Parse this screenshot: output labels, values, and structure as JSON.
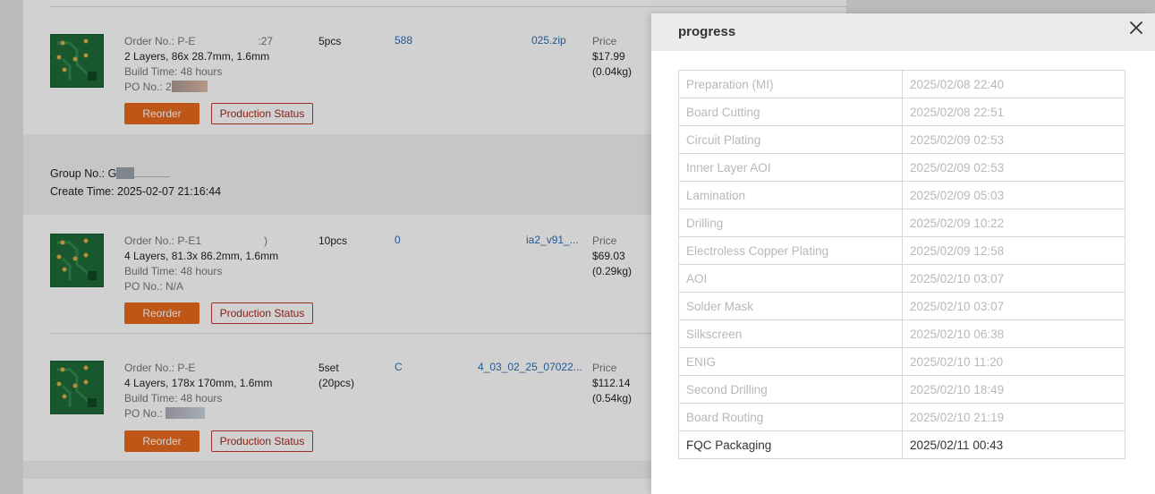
{
  "orders_top": {
    "order_no": "Order No.: P-E",
    "order_suffix": ":27",
    "specs": "2 Layers, 86x 28.7mm, 1.6mm",
    "build_time": "Build Time: 48 hours",
    "po_no": "PO No.: 2",
    "qty": "5pcs",
    "link": "588",
    "file": "025.zip",
    "price_label": "Price",
    "price": "$17.99",
    "weight": "(0.04kg)",
    "reorder": "Reorder",
    "status": "Production Status"
  },
  "group": {
    "group_no": "Group No.: G",
    "create_time": "Create Time: 2025-02-07 21:16:44"
  },
  "orders": [
    {
      "order_no": "Order No.: P-E1",
      "order_suffix": ")",
      "specs": "4 Layers, 81.3x 86.2mm, 1.6mm",
      "build_time": "Build Time: 48 hours",
      "po_no": "PO No.: N/A",
      "qty": "10pcs",
      "link": "0",
      "file": "ia2_v91_...",
      "price_label": "Price",
      "price": "$69.03",
      "weight": "(0.29kg)",
      "reorder": "Reorder",
      "status": "Production Status"
    },
    {
      "order_no": "Order No.: P-E",
      "order_suffix": "",
      "specs": "4 Layers, 178x 170mm, 1.6mm",
      "build_time": "Build Time: 48 hours",
      "po_no": "PO No.: ",
      "qty": "5set",
      "qty2": "(20pcs)",
      "link": "C",
      "file": "4_03_02_25_07022...",
      "price_label": "Price",
      "price": "$112.14",
      "weight": "(0.54kg)",
      "reorder": "Reorder",
      "status": "Production Status"
    }
  ],
  "modal": {
    "title": "progress",
    "close_icon": "close-icon",
    "steps": [
      {
        "name": "Preparation (MI)",
        "time": "2025/02/08 22:40"
      },
      {
        "name": "Board Cutting",
        "time": "2025/02/08 22:51"
      },
      {
        "name": "Circuit Plating",
        "time": "2025/02/09 02:53"
      },
      {
        "name": "Inner Layer AOI",
        "time": "2025/02/09 02:53"
      },
      {
        "name": "Lamination",
        "time": "2025/02/09 05:03"
      },
      {
        "name": "Drilling",
        "time": "2025/02/09 10:22"
      },
      {
        "name": "Electroless Copper Plating",
        "time": "2025/02/09 12:58"
      },
      {
        "name": "AOI",
        "time": "2025/02/10 03:07"
      },
      {
        "name": "Solder Mask",
        "time": "2025/02/10 03:07"
      },
      {
        "name": "Silkscreen",
        "time": "2025/02/10 06:38"
      },
      {
        "name": "ENIG",
        "time": "2025/02/10 11:20"
      },
      {
        "name": "Second Drilling",
        "time": "2025/02/10 18:49"
      },
      {
        "name": "Board Routing",
        "time": "2025/02/10 21:19"
      },
      {
        "name": "FQC Packaging",
        "time": "2025/02/11 00:43"
      }
    ]
  },
  "colors": {
    "accent": "#e8691e",
    "status_border": "#c0392b",
    "link": "#2f6db5",
    "pcb_green": "#1f6b3a"
  }
}
